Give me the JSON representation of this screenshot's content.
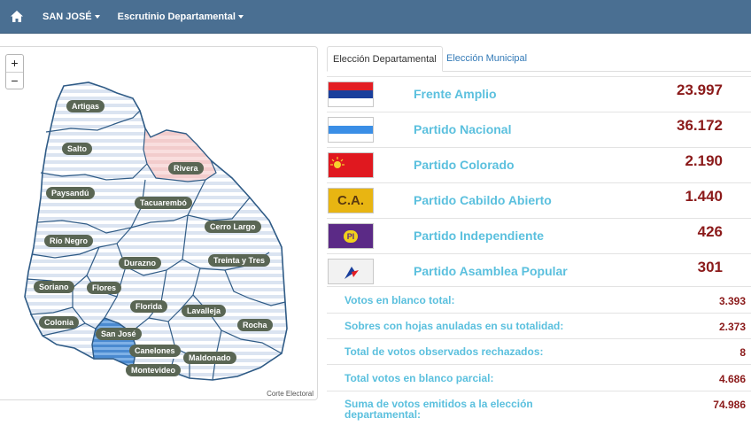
{
  "nav": {
    "department": "SAN JOSÉ",
    "section": "Escrutinio Departamental"
  },
  "icons": {
    "home": "home-icon",
    "caret": "caret-down-icon"
  },
  "map": {
    "zoom_in": "+",
    "zoom_out": "−",
    "attribution": "Corte Electoral",
    "selected_department": "San José",
    "departments": {
      "artigas": "Artigas",
      "salto": "Salto",
      "rivera": "Rivera",
      "paysandu": "Paysandú",
      "tacuarembo": "Tacuarembó",
      "cerro_largo": "Cerro Largo",
      "rio_negro": "Río Negro",
      "treinta_y_tres": "Treinta y Tres",
      "durazno": "Durazno",
      "soriano": "Soriano",
      "flores": "Flores",
      "florida": "Florida",
      "lavalleja": "Lavalleja",
      "colonia": "Colonia",
      "rocha": "Rocha",
      "san_jose": "San José",
      "canelones": "Canelones",
      "maldonado": "Maldonado",
      "montevideo": "Montevideo"
    }
  },
  "tabs": {
    "departamental": "Elección Departamental",
    "municipal": "Elección Municipal",
    "active": "departamental"
  },
  "parties": [
    {
      "name": "Frente Amplio",
      "votes": "23.997",
      "flag": "fa-flag"
    },
    {
      "name": "Partido Nacional",
      "votes": "36.172",
      "flag": "pn-flag"
    },
    {
      "name": "Partido Colorado",
      "votes": "2.190",
      "flag": "pc-flag"
    },
    {
      "name": "Partido Cabildo Abierto",
      "votes": "1.440",
      "flag": "ca-flag",
      "flag_text": "C.A."
    },
    {
      "name": "Partido Independiente",
      "votes": "426",
      "flag": "pi-flag",
      "flag_text": "PI"
    },
    {
      "name": "Partido Asamblea Popular",
      "votes": "301",
      "flag": "ap-flag"
    }
  ],
  "stats": [
    {
      "label": "Votos en blanco total:",
      "value": "3.393"
    },
    {
      "label": "Sobres con hojas anuladas en su totalidad:",
      "value": "2.373"
    },
    {
      "label": "Total de votos observados rechazados:",
      "value": "8"
    },
    {
      "label": "Total votos en blanco parcial:",
      "value": "4.686"
    },
    {
      "label": "Suma de votos emitidos a la elección departamental:",
      "value": "74.986"
    }
  ],
  "colors": {
    "navbar": "#4a6f92",
    "party_name": "#5bc0de",
    "votes": "#8b1a1a",
    "map_border": "#2f5b86",
    "map_fill_stripe": "#dbe4f1",
    "frente_amplio_region": "#f9dede",
    "selected_region": "#5b9bdc",
    "label_bg": "#5a6654"
  }
}
